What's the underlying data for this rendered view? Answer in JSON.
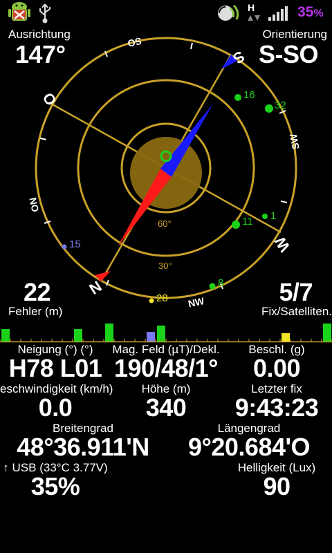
{
  "statusbar": {
    "battery_percent": "35",
    "battery_unit": "%",
    "network_type": "H",
    "icons": [
      "android-debug-icon",
      "usb-icon",
      "gps-signal-icon",
      "data-transfer-icon",
      "signal-bars-icon"
    ],
    "battery_color": "#b633e6"
  },
  "heading": {
    "left_label": "Ausrichtung",
    "left_value": "147°",
    "right_label": "Orientierung",
    "right_value": "S-SO"
  },
  "compass": {
    "cardinals": {
      "n": "N",
      "s": "S",
      "o": "O",
      "w": "W"
    },
    "intercardinals": {
      "so": "SO",
      "sw": "SW",
      "nw": "NW",
      "no": "NO"
    },
    "elevation_rings": [
      "60°",
      "30°"
    ],
    "satellites": [
      {
        "id": "16",
        "color": "#19d219"
      },
      {
        "id": "32",
        "color": "#19d219"
      },
      {
        "id": "11",
        "color": "#19d219"
      },
      {
        "id": "1",
        "color": "#19d219"
      },
      {
        "id": "15",
        "color": "#7878f0"
      },
      {
        "id": "8",
        "color": "#19d219"
      },
      {
        "id": "28",
        "color": "#f0e628"
      }
    ],
    "colors": {
      "ring": "#c9a227",
      "needle_north": "#ff1a1a",
      "needle_south": "#1a1aff",
      "accuracy": "#8a6a10"
    }
  },
  "metrics_top": {
    "error_value": "22",
    "error_label": "Fehler (m)",
    "fix_value": "5/7",
    "fix_label": "Fix/Satelliten."
  },
  "snr_bars": [
    {
      "color": "#19d219",
      "level": 0.6
    },
    {
      "color": "#19d219",
      "level": 0.6
    },
    {
      "color": "#19d219",
      "level": 0.85
    },
    {
      "color": "#7878f0",
      "level": 0.45
    },
    {
      "color": "#19d219",
      "level": 0.75
    },
    {
      "color": "#f0e628",
      "level": 0.4
    },
    {
      "color": "#19d219",
      "level": 0.85
    }
  ],
  "grid": {
    "r1": [
      {
        "label": "Neigung (°) (°)",
        "value": "H78 L01"
      },
      {
        "label": "Mag. Feld (µT)/Dekl.",
        "value": "190/48/1°"
      },
      {
        "label": "Beschl. (g)",
        "value": "0.00"
      }
    ],
    "r2": [
      {
        "label": "eschwindigkeit (km/h)",
        "value": "0.0"
      },
      {
        "label": "Höhe (m)",
        "value": "340"
      },
      {
        "label": "Letzter fix",
        "value": "9:43:23"
      }
    ],
    "r3": [
      {
        "label": "Breitengrad",
        "value": "48°36.911'N"
      },
      {
        "label": "Längengrad",
        "value": "9°20.684'O"
      }
    ],
    "r4": [
      {
        "label": "↑ USB (33°C 3.77V)",
        "value": "35%"
      },
      {
        "label": "Helligkeit (Lux)",
        "value": "90"
      }
    ]
  }
}
